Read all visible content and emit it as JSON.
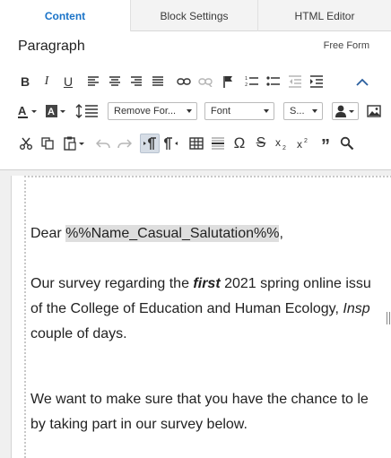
{
  "tabs": [
    {
      "label": "Content",
      "active": true
    },
    {
      "label": "Block Settings",
      "active": false
    },
    {
      "label": "HTML Editor",
      "active": false
    }
  ],
  "toolbar": {
    "paragraph_format": "Paragraph",
    "free_form": "Free Form",
    "style_select": "Remove For...",
    "font_select": "Font",
    "size_select": "S..."
  },
  "editor": {
    "greeting_prefix": "Dear ",
    "merge_tag": "%%Name_Casual_Salutation%%",
    "greeting_suffix": ",",
    "p1_line1_a": "Our survey regarding the ",
    "p1_line1_b": "first",
    "p1_line1_c": " 2021 spring online issu",
    "p1_line2_a": "of the College of Education and Human Ecology, ",
    "p1_line2_b": "Insp",
    "p1_line3": "couple of days.",
    "p2_line1": "We want to make sure that you have the chance to le",
    "p2_line2": "by taking part in our survey below."
  },
  "colors": {
    "accent": "#1a73c8",
    "merge_bg": "#dedede",
    "toolbar_active": "#d6dde6"
  }
}
